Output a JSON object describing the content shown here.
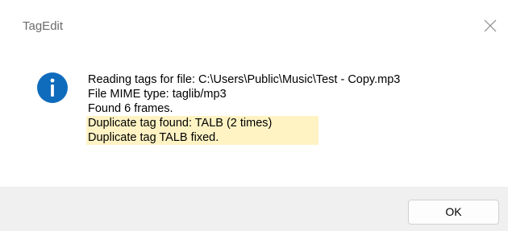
{
  "window": {
    "title": "TagEdit"
  },
  "message": {
    "icon": "info-icon",
    "lines": [
      "Reading tags for file: C:\\Users\\Public\\Music\\Test - Copy.mp3",
      "File MIME type: taglib/mp3",
      "Found 6 frames."
    ],
    "highlighted_lines": [
      "Duplicate tag found: TALB (2 times)",
      "Duplicate tag TALB fixed."
    ]
  },
  "buttons": {
    "ok_label": "OK"
  },
  "colors": {
    "info_icon": "#0f6cbd",
    "highlight": "#fff3c4",
    "footer": "#f0f0f0",
    "title_text": "#6b6b6b"
  }
}
